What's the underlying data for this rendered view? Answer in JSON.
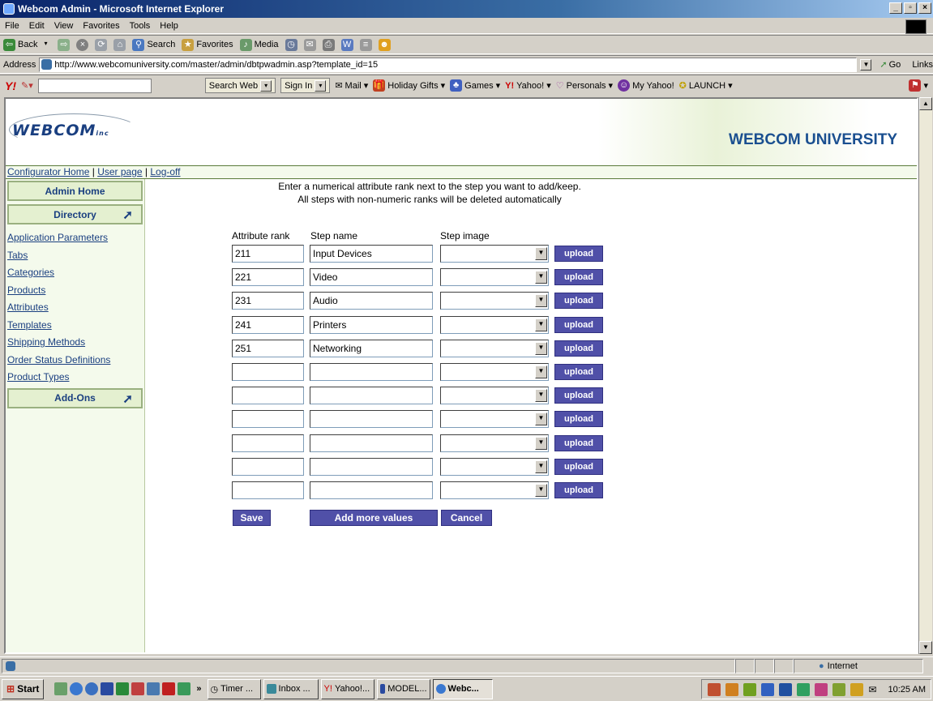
{
  "window": {
    "title": "Webcom Admin - Microsoft Internet Explorer"
  },
  "menu": [
    "File",
    "Edit",
    "View",
    "Favorites",
    "Tools",
    "Help"
  ],
  "toolbar": {
    "back": "Back",
    "search": "Search",
    "favorites": "Favorites",
    "media": "Media"
  },
  "address": {
    "label": "Address",
    "url": "http://www.webcomuniversity.com/master/admin/dbtpwadmin.asp?template_id=15",
    "go": "Go",
    "links": "Links"
  },
  "yahoo": {
    "search_web": "Search Web",
    "sign_in": "Sign In",
    "mail": "Mail",
    "holiday": "Holiday Gifts",
    "games": "Games",
    "yahoo": "Yahoo!",
    "personals": "Personals",
    "myyahoo": "My Yahoo!",
    "launch": "LAUNCH"
  },
  "banner": {
    "logo": "WEBCOM",
    "logo_suffix": "inc",
    "university": "WEBCOM UNIVERSITY"
  },
  "nav": {
    "home": "Configurator Home",
    "user": "User page",
    "logoff": "Log-off",
    "sep": " | "
  },
  "sidebar": {
    "admin_home": "Admin Home",
    "directory": "Directory",
    "links": [
      "Application Parameters",
      "Tabs",
      "Categories",
      "Products",
      "Attributes",
      "Templates",
      "Shipping Methods",
      "Order Status Definitions",
      "Product Types"
    ],
    "addons": "Add-Ons"
  },
  "instructions": {
    "line1": "Enter a numerical attribute rank next to the step you want to add/keep.",
    "line2": "All steps with non-numeric ranks will be deleted automatically"
  },
  "table": {
    "headers": {
      "rank": "Attribute rank",
      "name": "Step name",
      "image": "Step image"
    },
    "upload_label": "upload",
    "rows": [
      {
        "rank": "211",
        "name": "Input Devices"
      },
      {
        "rank": "221",
        "name": "Video"
      },
      {
        "rank": "231",
        "name": "Audio"
      },
      {
        "rank": "241",
        "name": "Printers"
      },
      {
        "rank": "251",
        "name": "Networking"
      },
      {
        "rank": "",
        "name": ""
      },
      {
        "rank": "",
        "name": ""
      },
      {
        "rank": "",
        "name": ""
      },
      {
        "rank": "",
        "name": ""
      },
      {
        "rank": "",
        "name": ""
      },
      {
        "rank": "",
        "name": ""
      }
    ]
  },
  "actions": {
    "save": "Save",
    "add_more": "Add more values",
    "cancel": "Cancel"
  },
  "status": {
    "zone": "Internet"
  },
  "taskbar": {
    "start": "Start",
    "tasks": [
      "Timer ...",
      "Inbox ...",
      "Yahoo!...",
      "MODEL...",
      "Webc..."
    ],
    "time": "10:25 AM"
  }
}
